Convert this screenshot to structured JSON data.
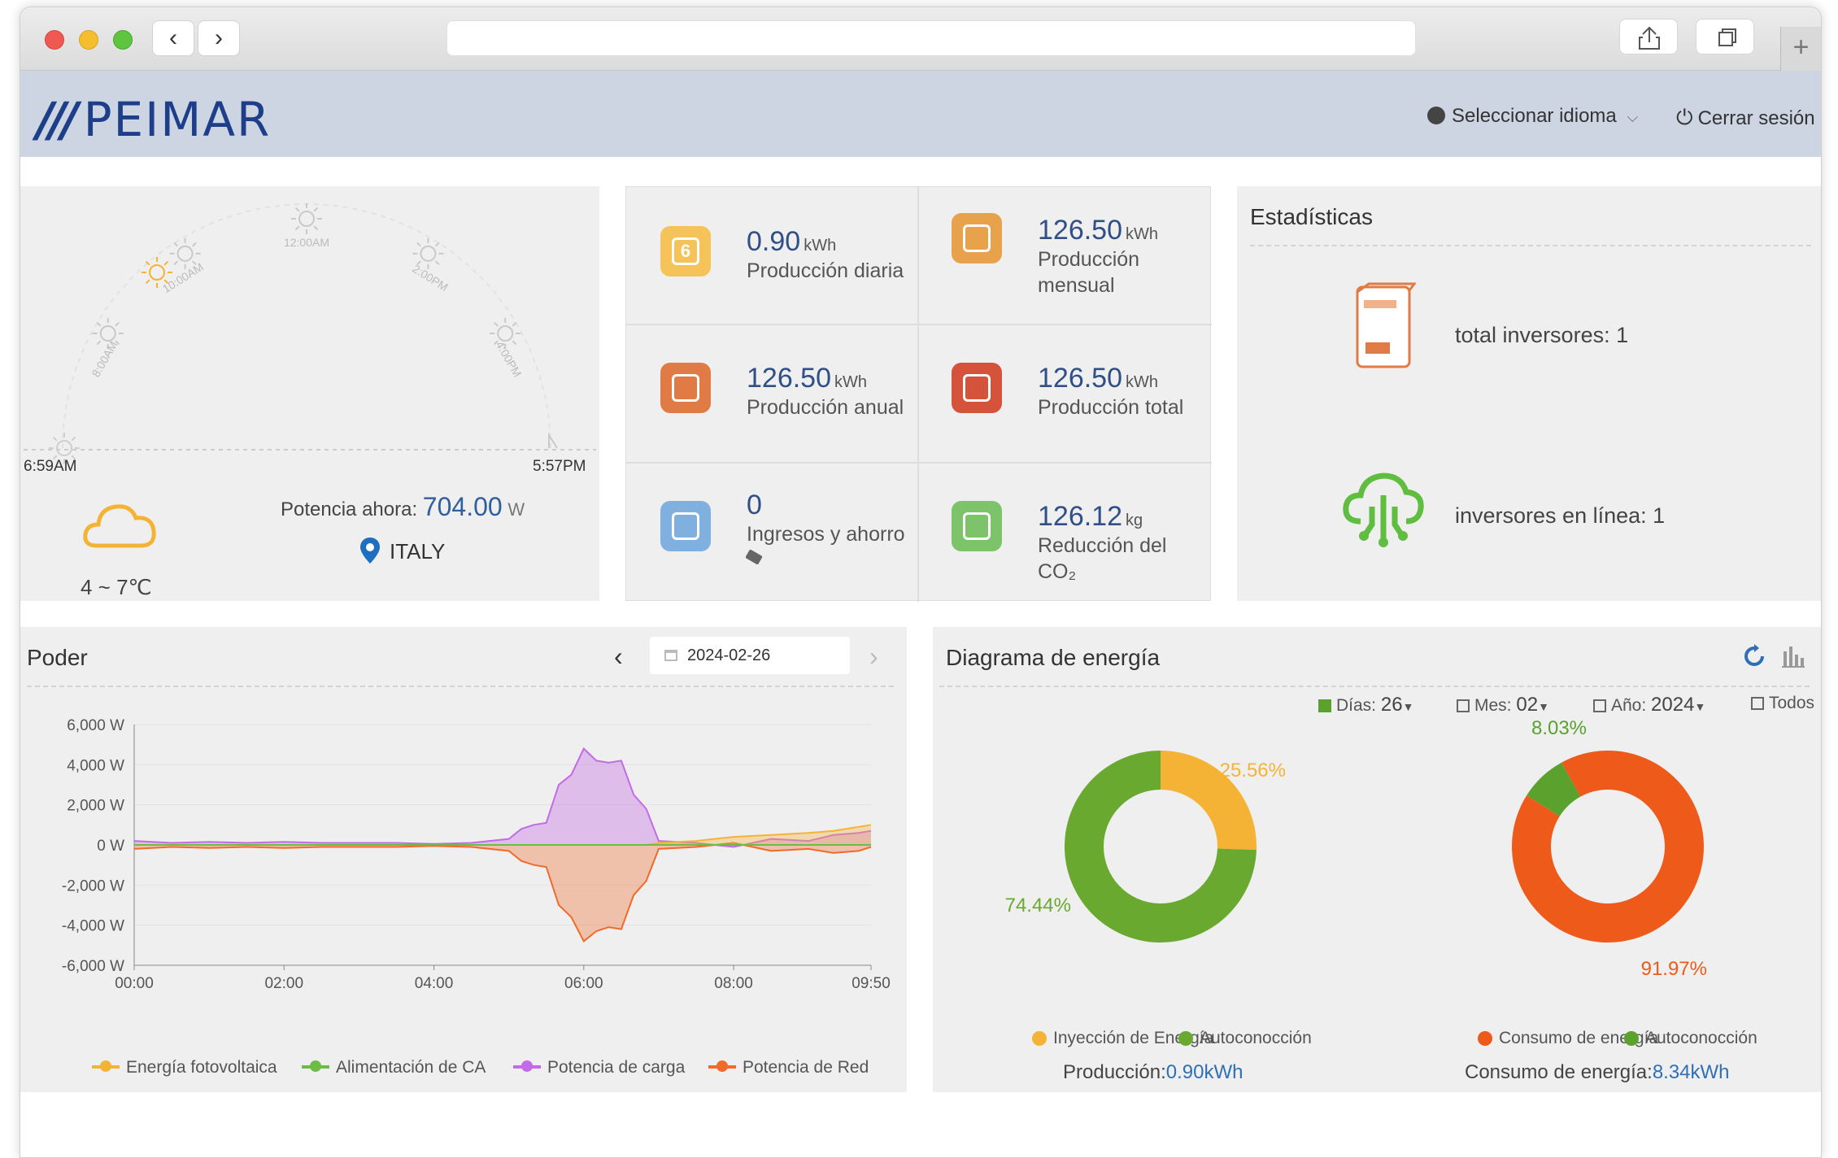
{
  "header": {
    "logo": "PEIMAR",
    "logo_prefix": "///",
    "language_label": "Seleccionar idioma",
    "logout_label": "Cerrar sesión"
  },
  "weather": {
    "sunrise": "6:59AM",
    "sunset": "5:57PM",
    "hour_labels": [
      "8:00AM",
      "10:00AM",
      "12:00AM",
      "2:00PM",
      "4:00PM"
    ],
    "power_label": "Potencia ahora:",
    "power_value": "704.00",
    "power_unit": "W",
    "location": "ITALY",
    "temperature": "4 ~ 7℃"
  },
  "stats_tiles": [
    {
      "value": "0.90",
      "unit": "kWh",
      "label": "Producción diaria",
      "icon": "calendar-day-icon",
      "color": "#f5c35a",
      "badge": "6"
    },
    {
      "value": "126.50",
      "unit": "kWh",
      "label": "Producción mensual",
      "icon": "calendar-month-icon",
      "color": "#e8a24b"
    },
    {
      "value": "126.50",
      "unit": "kWh",
      "label": "Producción anual",
      "icon": "globe-icon",
      "color": "#e07b46"
    },
    {
      "value": "126.50",
      "unit": "kWh",
      "label": "Producción total",
      "icon": "lightning-icon",
      "color": "#d5533a"
    },
    {
      "value": "0",
      "unit": "",
      "label": "Ingresos y ahorro",
      "icon": "coins-icon",
      "color": "#7fb0e0"
    },
    {
      "value": "126.12",
      "unit": "kg",
      "label": "Reducción del CO₂",
      "icon": "co2-cloud-icon",
      "color": "#7cc36a"
    }
  ],
  "estadisticas": {
    "title": "Estadísticas",
    "total_inverters": "total inversores: 1",
    "online_inverters": "inversores en línea: 1"
  },
  "poder": {
    "title": "Poder",
    "date": "2024-02-26",
    "legend": [
      {
        "name": "Energía fotovoltaica",
        "color": "#f5b335"
      },
      {
        "name": "Alimentación de CA",
        "color": "#6dbd45"
      },
      {
        "name": "Potencia de carga",
        "color": "#c36be6"
      },
      {
        "name": "Potencia de Red",
        "color": "#f06a2a"
      }
    ]
  },
  "chart_data": {
    "type": "area",
    "x": [
      "00:00",
      "00:30",
      "01:00",
      "01:30",
      "02:00",
      "02:30",
      "03:00",
      "03:30",
      "04:00",
      "04:30",
      "05:00",
      "05:10",
      "05:20",
      "05:30",
      "05:40",
      "05:50",
      "06:00",
      "06:10",
      "06:20",
      "06:30",
      "06:40",
      "06:50",
      "07:00",
      "07:30",
      "08:00",
      "08:30",
      "09:00",
      "09:20",
      "09:40",
      "09:50"
    ],
    "x_ticks": [
      "00:00",
      "02:00",
      "04:00",
      "06:00",
      "08:00",
      "09:50"
    ],
    "ylim": [
      -6000,
      6000
    ],
    "y_ticks": [
      "6,000 W",
      "4,000 W",
      "2,000 W",
      "0 W",
      "-2,000 W",
      "-4,000 W",
      "-6,000 W"
    ],
    "y_tick_values": [
      6000,
      4000,
      2000,
      0,
      -2000,
      -4000,
      -6000
    ],
    "series": [
      {
        "name": "Energía fotovoltaica",
        "values": [
          0,
          0,
          0,
          0,
          0,
          0,
          0,
          0,
          0,
          0,
          0,
          0,
          0,
          0,
          0,
          0,
          0,
          0,
          0,
          0,
          0,
          0,
          100,
          200,
          400,
          500,
          600,
          700,
          900,
          1000
        ]
      },
      {
        "name": "Alimentación de CA",
        "values": [
          0,
          0,
          0,
          0,
          0,
          0,
          0,
          0,
          0,
          0,
          0,
          0,
          0,
          0,
          0,
          0,
          0,
          0,
          0,
          0,
          0,
          0,
          0,
          0,
          0,
          0,
          0,
          0,
          0,
          0
        ]
      },
      {
        "name": "Potencia de carga",
        "values": [
          200,
          100,
          150,
          100,
          150,
          100,
          100,
          100,
          50,
          100,
          300,
          800,
          1000,
          1100,
          3000,
          3500,
          4800,
          4200,
          4100,
          4200,
          2500,
          1800,
          200,
          100,
          -100,
          300,
          200,
          500,
          600,
          700
        ]
      },
      {
        "name": "Potencia de Red",
        "values": [
          -200,
          -100,
          -150,
          -100,
          -150,
          -100,
          -100,
          -100,
          -50,
          -100,
          -300,
          -800,
          -1000,
          -1100,
          -3000,
          -3600,
          -4800,
          -4300,
          -4100,
          -4200,
          -2500,
          -1800,
          -200,
          -100,
          100,
          -300,
          -200,
          -400,
          -300,
          -100
        ]
      }
    ]
  },
  "energia": {
    "title": "Diagrama de energía",
    "controls": {
      "dias_label": "Días:",
      "dias_value": "26",
      "mes_label": "Mes:",
      "mes_value": "02",
      "ano_label": "Año:",
      "ano_value": "2024",
      "todos_label": "Todos"
    },
    "donut1": {
      "slices": [
        {
          "name": "Inyección de Energía",
          "value": 25.56,
          "label": "25.56%",
          "color": "#f5b335"
        },
        {
          "name": "Autoconocción",
          "value": 74.44,
          "label": "74.44%",
          "color": "#6aa92f"
        }
      ],
      "footer_label": "Producción:",
      "footer_value": "0.90kWh"
    },
    "donut2": {
      "slices": [
        {
          "name": "Consumo de energía",
          "value": 91.97,
          "label": "91.97%",
          "color": "#ee5a1a"
        },
        {
          "name": "Autoconocción",
          "value": 8.03,
          "label": "8.03%",
          "color": "#5aa12e"
        }
      ],
      "footer_label": "Consumo de energía:",
      "footer_value": "8.34kWh"
    }
  }
}
